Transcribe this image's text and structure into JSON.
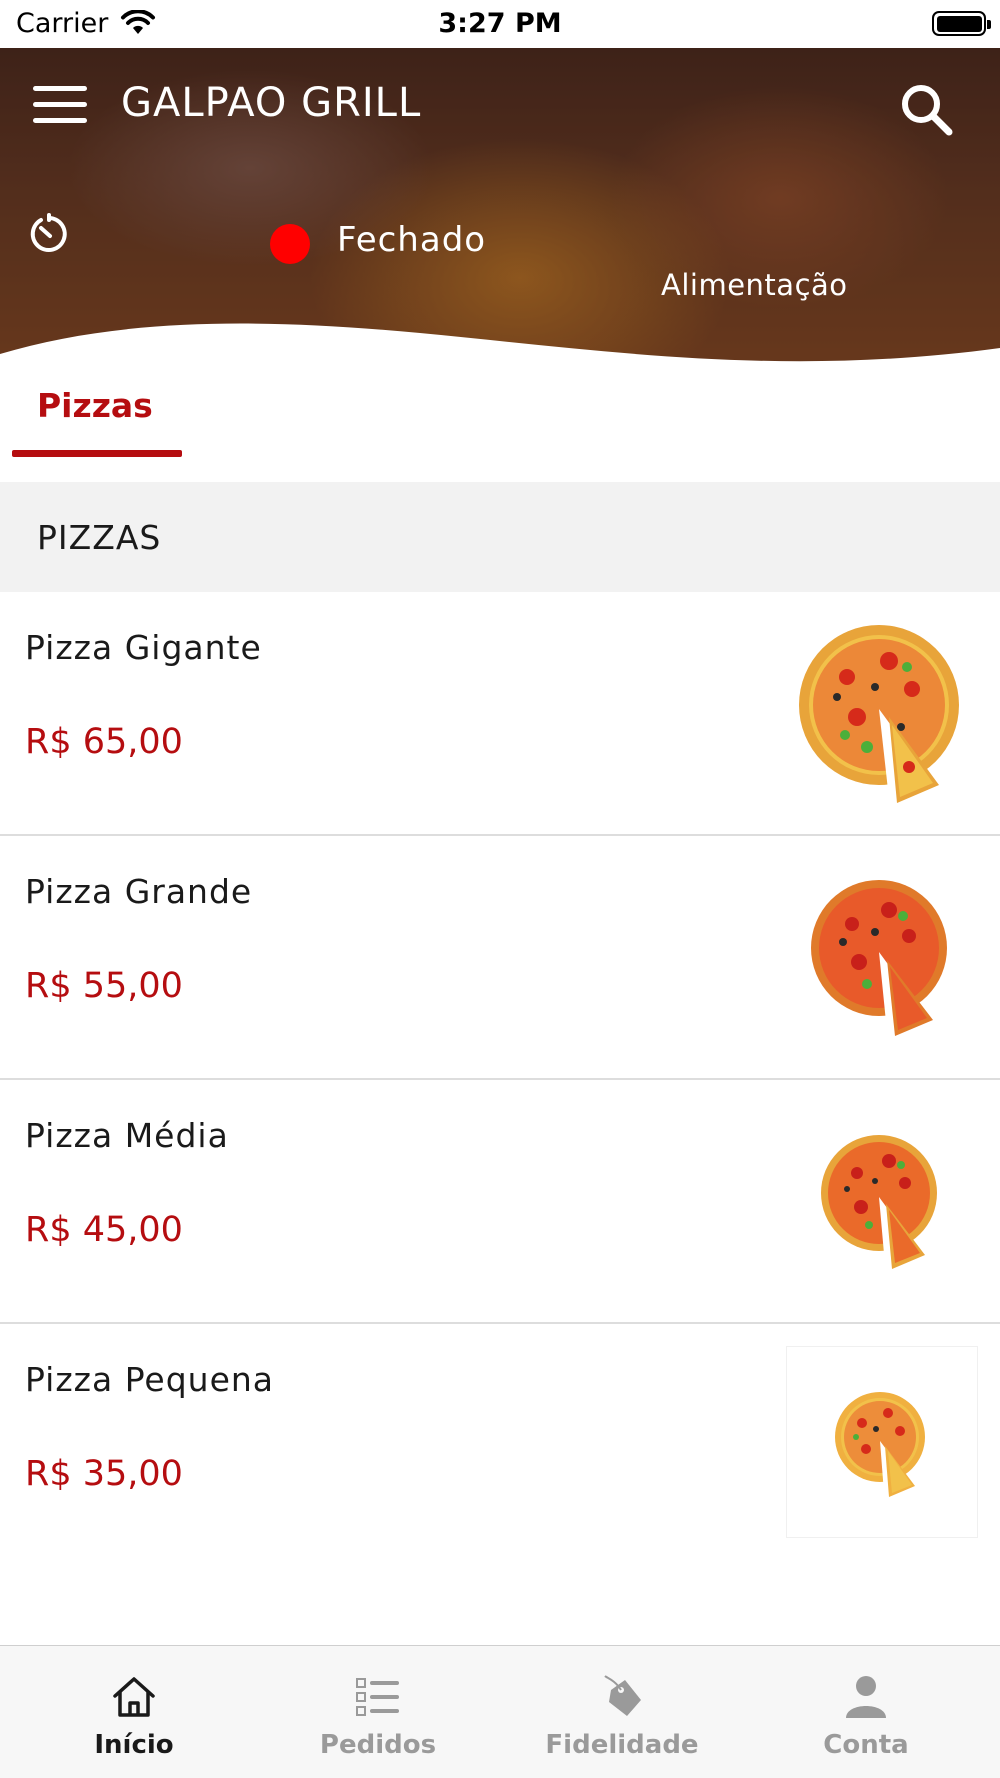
{
  "status_bar": {
    "carrier": "Carrier",
    "time": "3:27 PM"
  },
  "header": {
    "title": "GALPAO GRILL",
    "store_status": "Fechado",
    "store_status_color": "#ff0000",
    "category": "Alimentação",
    "icons": {
      "menu": "hamburger-menu-icon",
      "search": "search-icon",
      "timer": "timer-icon"
    }
  },
  "tabs": [
    {
      "label": "Pizzas",
      "active": true
    }
  ],
  "section": {
    "title": "PIZZAS"
  },
  "products": [
    {
      "name": "Pizza Gigante",
      "price": "R$ 65,00",
      "image": "pizza-image"
    },
    {
      "name": "Pizza Grande",
      "price": "R$ 55,00",
      "image": "pizza-image"
    },
    {
      "name": "Pizza Média",
      "price": "R$ 45,00",
      "image": "pizza-image"
    },
    {
      "name": "Pizza Pequena",
      "price": "R$ 35,00",
      "image": "pizza-image"
    }
  ],
  "bottom_tabs": [
    {
      "label": "Início",
      "icon": "home-icon",
      "active": true
    },
    {
      "label": "Pedidos",
      "icon": "list-icon",
      "active": false
    },
    {
      "label": "Fidelidade",
      "icon": "tag-icon",
      "active": false
    },
    {
      "label": "Conta",
      "icon": "person-icon",
      "active": false
    }
  ],
  "colors": {
    "accent": "#b50d10",
    "status_closed": "#ff0000",
    "tab_inactive": "#9a9a9a"
  }
}
